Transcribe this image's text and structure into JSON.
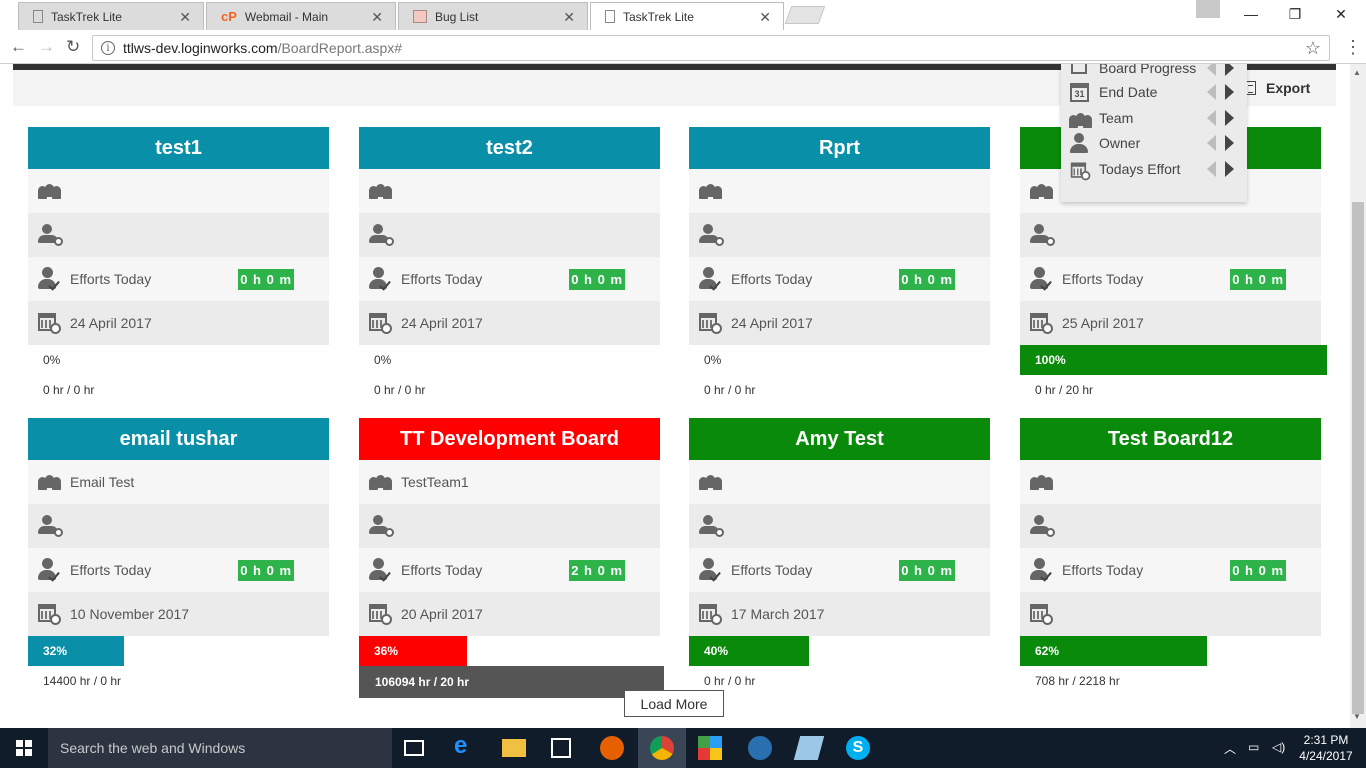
{
  "browser": {
    "tabs": [
      {
        "label": "TaskTrek Lite",
        "active": false
      },
      {
        "label": "Webmail - Main",
        "active": false
      },
      {
        "label": "Bug List",
        "active": false
      },
      {
        "label": "TaskTrek Lite",
        "active": true
      }
    ],
    "url_host": "ttlws-dev.loginworks.com",
    "url_path": "/BoardReport.aspx#"
  },
  "toolbar": {
    "export_label": "Export"
  },
  "column_menu": {
    "items": [
      {
        "label": "Board Progress",
        "icon": "board-progress-icon"
      },
      {
        "label": "End Date",
        "icon": "calendar-31-icon"
      },
      {
        "label": "Team",
        "icon": "team-icon"
      },
      {
        "label": "Owner",
        "icon": "owner-icon"
      },
      {
        "label": "Todays Effort",
        "icon": "effort-icon"
      }
    ]
  },
  "colors": {
    "teal": "#0a8fa8",
    "green": "#0a8a0a",
    "red": "#ff0000",
    "badge_green": "#2db34a"
  },
  "boards": [
    {
      "title": "test1",
      "color": "#0a8fa8",
      "team": "",
      "effort_label": "Efforts Today",
      "effort": "0 h 0 m",
      "date": "24 April 2017",
      "progress_text": "0%",
      "progress": 0,
      "hours": "0 hr / 0 hr"
    },
    {
      "title": "test2",
      "color": "#0a8fa8",
      "team": "",
      "effort_label": "Efforts Today",
      "effort": "0 h 0 m",
      "date": "24 April 2017",
      "progress_text": "0%",
      "progress": 0,
      "hours": "0 hr / 0 hr"
    },
    {
      "title": "Rprt",
      "color": "#0a8fa8",
      "team": "",
      "effort_label": "Efforts Today",
      "effort": "0 h 0 m",
      "date": "24 April 2017",
      "progress_text": "0%",
      "progress": 0,
      "hours": "0 hr / 0 hr"
    },
    {
      "title": "",
      "color": "#0a8a0a",
      "team": "",
      "effort_label": "Efforts Today",
      "effort": "0 h 0 m",
      "date": "25 April 2017",
      "progress_text": "100%",
      "progress": 100,
      "hours": "0 hr / 20 hr"
    },
    {
      "title": "email tushar",
      "color": "#0a8fa8",
      "team": "Email Test",
      "effort_label": "Efforts Today",
      "effort": "0 h 0 m",
      "date": "10 November 2017",
      "progress_text": "32%",
      "progress": 32,
      "hours": "14400 hr / 0 hr"
    },
    {
      "title": "TT Development Board",
      "color": "#ff0000",
      "team": "TestTeam1",
      "effort_label": "Efforts Today",
      "effort": "2 h 0 m",
      "date": "20 April 2017",
      "progress_text": "36%",
      "progress": 36,
      "hours": "106094 hr / 20 hr"
    },
    {
      "title": "Amy Test",
      "color": "#0a8a0a",
      "team": "",
      "effort_label": "Efforts Today",
      "effort": "0 h 0 m",
      "date": "17 March 2017",
      "progress_text": "40%",
      "progress": 40,
      "hours": "0 hr / 0 hr"
    },
    {
      "title": "Test Board12",
      "color": "#0a8a0a",
      "team": "",
      "effort_label": "Efforts Today",
      "effort": "0 h 0 m",
      "date": "",
      "progress_text": "62%",
      "progress": 62,
      "hours": "708 hr / 2218 hr"
    }
  ],
  "load_more_label": "Load More",
  "taskbar": {
    "search_placeholder": "Search the web and Windows",
    "time": "2:31 PM",
    "date": "4/24/2017"
  }
}
